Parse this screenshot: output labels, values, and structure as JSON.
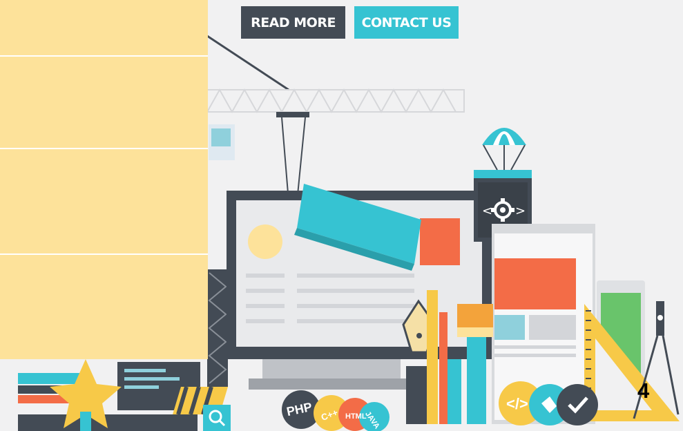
{
  "buttons": {
    "read_more": "READ MORE",
    "contact_us": "CONTACT US"
  },
  "side_panel": {
    "blocks": [
      "",
      "",
      "",
      ""
    ],
    "color": "#fde29a"
  },
  "badges": {
    "php": "PHP",
    "cpp": "C++",
    "html": "HTML",
    "java": "JAVA",
    "code": "</>"
  },
  "slide_number": "4",
  "colors": {
    "dark": "#434b55",
    "cyan": "#36c3d2",
    "orange": "#f36c47",
    "yellow": "#f7c948",
    "green": "#69c46b",
    "background": "#f1f1f2"
  },
  "icons": [
    "crane",
    "parachute",
    "gear-icon",
    "monitor",
    "ruler",
    "pen-nib",
    "brush",
    "tablet",
    "compass",
    "search-icon",
    "star-medal",
    "checkmark-icon"
  ]
}
